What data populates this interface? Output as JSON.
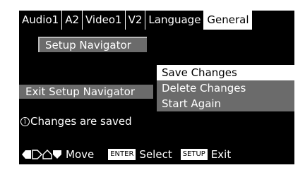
{
  "tabs": [
    {
      "label": "Audio1",
      "active": false
    },
    {
      "label": "A2",
      "active": false
    },
    {
      "label": "Video1",
      "active": false
    },
    {
      "label": "V2",
      "active": false
    },
    {
      "label": "Language",
      "active": false
    },
    {
      "label": "General",
      "active": true
    }
  ],
  "buttons": {
    "setup_navigator": "Setup Navigator",
    "exit_setup_navigator": "Exit Setup Navigator"
  },
  "menu": {
    "items": [
      {
        "label": "Save Changes",
        "selected": true
      },
      {
        "label": "Delete Changes",
        "selected": false
      },
      {
        "label": "Start Again",
        "selected": false
      }
    ]
  },
  "status": {
    "icon": "info-icon",
    "text": "Changes are saved"
  },
  "footer": {
    "arrow_icons": [
      "arrow-left-icon",
      "arrow-right-icon",
      "arrow-up-icon",
      "arrow-down-icon"
    ],
    "move_label": "Move",
    "enter_key": "ENTER",
    "select_label": "Select",
    "setup_key": "SETUP",
    "exit_label": "Exit"
  },
  "colors": {
    "background": "#000000",
    "active_tab": "#ffffff",
    "button_grey": "#6b6b6b",
    "text": "#ffffff"
  }
}
